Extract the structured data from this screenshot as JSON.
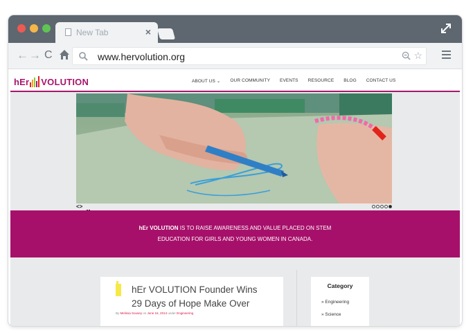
{
  "browser": {
    "tab_title": "New Tab",
    "tab_close": "×",
    "url": "www.hervolution.org",
    "star": "☆",
    "back": "←",
    "forward": "→",
    "reload": "C"
  },
  "site": {
    "logo_left": "hEr",
    "logo_right": "VOLUTION",
    "logo_colors": [
      "#e2231a",
      "#f7a11a",
      "#8dc63f",
      "#a6166b",
      "#0089cf"
    ],
    "brand_color": "#a6166b",
    "nav": [
      "ABOUT US ⌄",
      "OUR COMMUNITY",
      "EVENTS",
      "RESOURCE",
      "BLOG",
      "CONTACT US"
    ]
  },
  "slider": {
    "arrows": "<>",
    "dots": [
      false,
      false,
      false,
      false,
      true
    ]
  },
  "mission": {
    "brand": "hEr VOLUTION",
    "line1": " IS TO RAISE AWARENESS AND VALUE PLACED ON STEM",
    "line2": "EDUCATION FOR GIRLS AND YOUNG WOMEN IN CANADA."
  },
  "post": {
    "title": "hEr VOLUTION Founder Wins 29 Days of Hope Make Over",
    "meta_by": "By ",
    "meta_author": "Melissa Sousey",
    "meta_on": " on ",
    "meta_date": "June 16, 2014",
    "meta_under": " under ",
    "meta_category": "Engineering"
  },
  "sidebar": {
    "title": "Category",
    "items": [
      "» Engineering",
      "» Science"
    ]
  }
}
